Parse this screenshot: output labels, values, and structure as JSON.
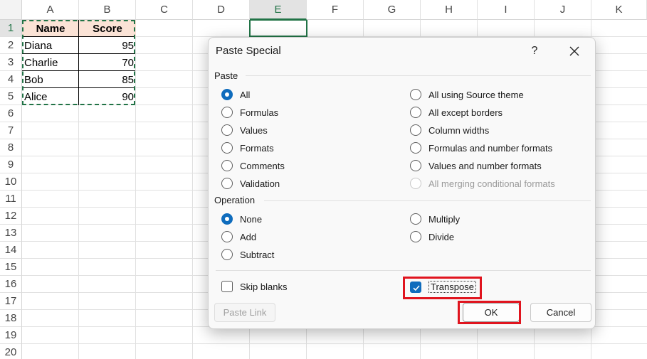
{
  "sheet": {
    "columns": [
      "A",
      "B",
      "C",
      "D",
      "E",
      "F",
      "G",
      "H",
      "I",
      "J",
      "K"
    ],
    "selected_column": "E",
    "rows": [
      "1",
      "2",
      "3",
      "4",
      "5",
      "6",
      "7",
      "8",
      "9",
      "10",
      "11",
      "12",
      "13",
      "14",
      "15",
      "16",
      "17",
      "18",
      "19",
      "20"
    ],
    "selected_row": "1",
    "table": {
      "header": [
        "Name",
        "Score"
      ],
      "rows": [
        [
          "Diana",
          "95"
        ],
        [
          "Charlie",
          "70"
        ],
        [
          "Bob",
          "85"
        ],
        [
          "Alice",
          "90"
        ]
      ]
    },
    "header_fill": "#fbe3d6",
    "accent": "#217346"
  },
  "dialog": {
    "title": "Paste Special",
    "help": "?",
    "paste_group": "Paste",
    "paste_left": [
      "All",
      "Formulas",
      "Values",
      "Formats",
      "Comments",
      "Validation"
    ],
    "paste_right": [
      "All using Source theme",
      "All except borders",
      "Column widths",
      "Formulas and number formats",
      "Values and number formats",
      "All merging conditional formats"
    ],
    "paste_selected": "All",
    "operation_group": "Operation",
    "operation_left": [
      "None",
      "Add",
      "Subtract"
    ],
    "operation_right": [
      "Multiply",
      "Divide"
    ],
    "operation_selected": "None",
    "skip_blanks": "Skip blanks",
    "transpose": "Transpose",
    "transpose_checked": true,
    "paste_link": "Paste Link",
    "ok": "OK",
    "cancel": "Cancel",
    "highlight_color": "#e0141e",
    "accent": "#0f6cbd"
  }
}
